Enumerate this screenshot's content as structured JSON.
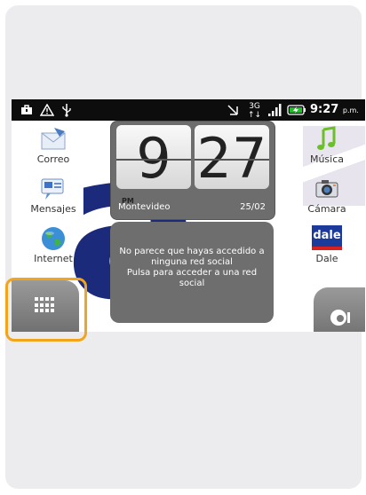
{
  "statusbar": {
    "network_type": "3G",
    "network_arrows": "↑↓",
    "time": "9:27",
    "time_suffix": "p.m."
  },
  "apps_left": [
    {
      "label": "Correo",
      "icon": "mail-icon"
    },
    {
      "label": "Mensajes",
      "icon": "messages-icon"
    },
    {
      "label": "Internet",
      "icon": "globe-icon"
    }
  ],
  "apps_right": [
    {
      "label": "Música",
      "icon": "music-icon"
    },
    {
      "label": "Cámara",
      "icon": "camera-icon"
    },
    {
      "label": "Dale",
      "icon": "dale-icon",
      "icon_text": "dale"
    }
  ],
  "clock": {
    "hour": "9",
    "minute": "27",
    "period": "PM",
    "city": "Montevideo",
    "date": "25/02"
  },
  "social": {
    "line1": "No parece que hayas accedido a ninguna red social",
    "line2": "Pulsa para acceder a una red social"
  },
  "colors": {
    "accent_highlight": "#f2a51a",
    "brand_blue": "#1b2a7a"
  }
}
